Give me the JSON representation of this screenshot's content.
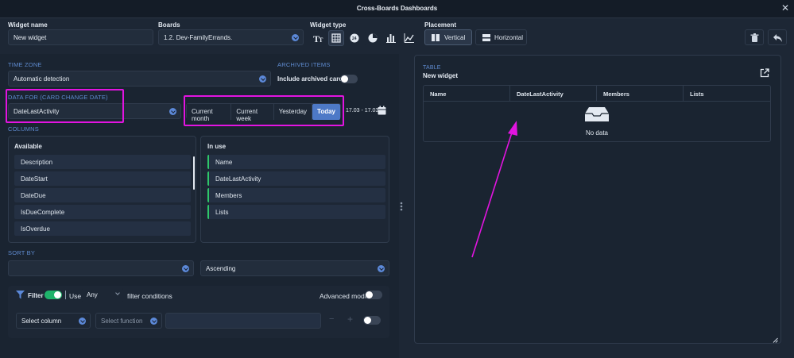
{
  "window": {
    "title": "Cross-Boards Dashboards"
  },
  "widget_name": {
    "label": "Widget name",
    "value": "New widget"
  },
  "boards": {
    "label": "Boards",
    "value": "1.2. Dev-FamilyErrands."
  },
  "widget_type": {
    "label": "Widget type",
    "options": [
      "text-icon",
      "table-icon",
      "counter-icon",
      "pie-chart-icon",
      "bar-chart-icon",
      "line-chart-icon"
    ],
    "selected": "table-icon"
  },
  "placement": {
    "label": "Placement",
    "vertical": "Vertical",
    "horizontal": "Horizontal",
    "selected": "Vertical"
  },
  "toolbar": {
    "delete_icon": "trash-icon",
    "back_icon": "undo-icon"
  },
  "time_zone": {
    "label": "TIME ZONE",
    "value": "Automatic detection"
  },
  "archived": {
    "label": "ARCHIVED ITEMS",
    "toggle_label": "Include archived cards",
    "on": false
  },
  "data_for": {
    "label": "DATA FOR (CARD CHANGE DATE)",
    "value": "DateLastActivity",
    "ranges": [
      "Current month",
      "Current week",
      "Yesterday",
      "Today"
    ],
    "active": "Today",
    "range_text": "17.03 - 17.03"
  },
  "columns": {
    "label": "COLUMNS",
    "available_title": "Available",
    "available": [
      "Description",
      "DateStart",
      "DateDue",
      "IsDueComplete",
      "IsOverdue"
    ],
    "in_use_title": "In use",
    "in_use": [
      "Name",
      "DateLastActivity",
      "Members",
      "Lists"
    ]
  },
  "sort_by": {
    "label": "SORT BY",
    "field": "",
    "order": "Ascending"
  },
  "filter": {
    "label": "Filter",
    "on": true,
    "use_label": "Use",
    "use_value": "Any",
    "conditions_label": "filter conditions",
    "advanced_label": "Advanced mode",
    "advanced_on": false,
    "select_column": "Select column",
    "select_function": "Select function",
    "minus": "−",
    "plus": "+"
  },
  "preview": {
    "type_label": "TABLE",
    "title": "New widget",
    "headers": [
      "Name",
      "DateLastActivity",
      "Members",
      "Lists"
    ],
    "empty_text": "No data"
  },
  "colors": {
    "accent": "#4d79c7",
    "annotation": "#e214e0",
    "toggle_on": "#1fb36b"
  }
}
